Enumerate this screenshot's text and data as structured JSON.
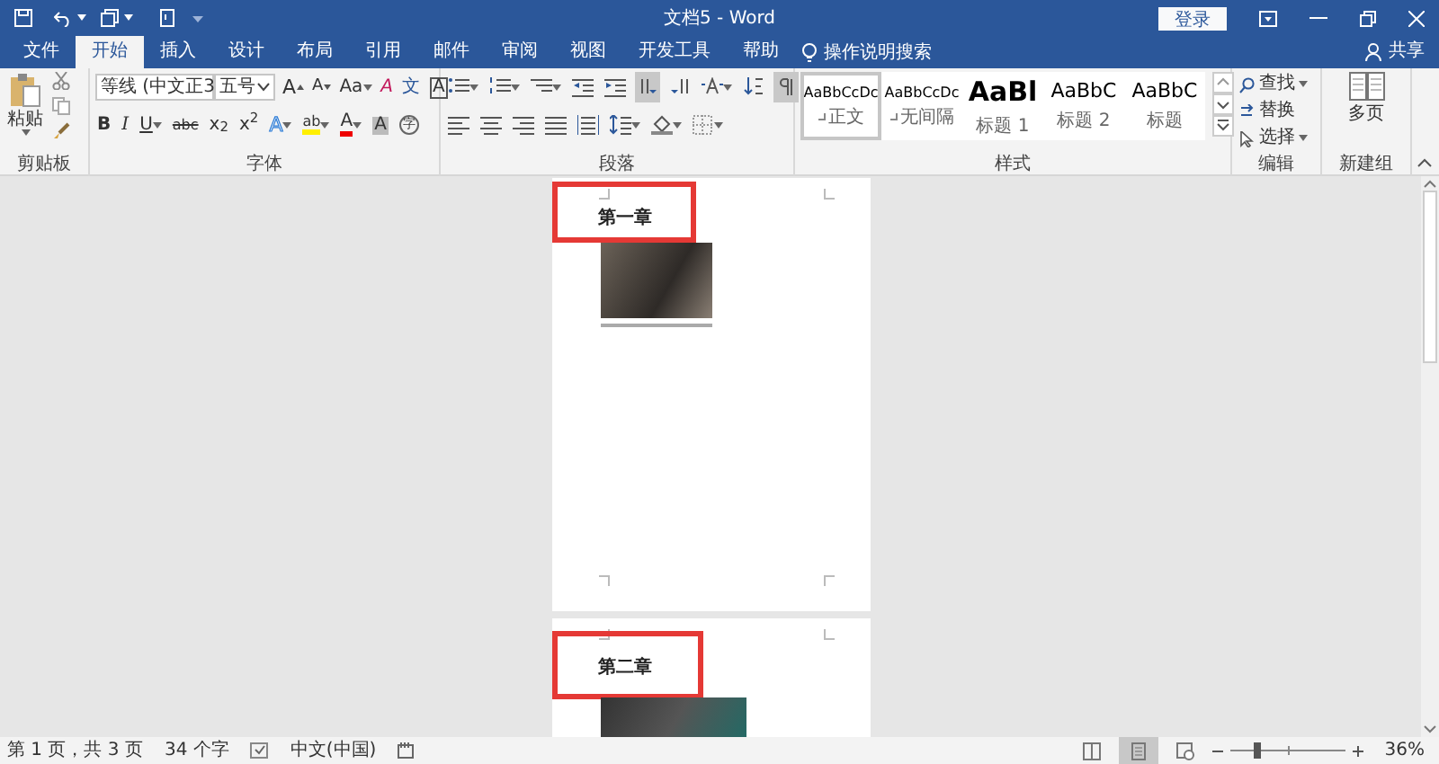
{
  "window": {
    "title": "文档5 - Word",
    "sign_in": "登录"
  },
  "tabs": [
    {
      "label": "文件",
      "selected": false
    },
    {
      "label": "开始",
      "selected": true
    },
    {
      "label": "插入",
      "selected": false
    },
    {
      "label": "设计",
      "selected": false
    },
    {
      "label": "布局",
      "selected": false
    },
    {
      "label": "引用",
      "selected": false
    },
    {
      "label": "邮件",
      "selected": false
    },
    {
      "label": "审阅",
      "selected": false
    },
    {
      "label": "视图",
      "selected": false
    },
    {
      "label": "开发工具",
      "selected": false
    },
    {
      "label": "帮助",
      "selected": false
    }
  ],
  "tell_me": "操作说明搜索",
  "share": "共享",
  "ribbon": {
    "clipboard": {
      "label": "剪贴板",
      "paste": "粘贴"
    },
    "font": {
      "label": "字体",
      "font_name": "等线 (中文正3",
      "font_size": "五号",
      "row1": [
        {
          "kind": "grow",
          "text": "A"
        },
        {
          "kind": "shrink",
          "text": "A"
        },
        {
          "kind": "case",
          "text": "Aa"
        },
        {
          "kind": "clear",
          "text": "A"
        },
        {
          "kind": "phonetic",
          "text": "文"
        },
        {
          "kind": "border",
          "text": "A"
        }
      ],
      "row2": [
        {
          "kind": "bold",
          "text": "B"
        },
        {
          "kind": "italic",
          "text": "I"
        },
        {
          "kind": "underline",
          "text": "U"
        },
        {
          "kind": "strike",
          "text": "abc"
        },
        {
          "kind": "plain",
          "text": "x$_{2}$"
        },
        {
          "kind": "plain",
          "text": "x$^{2}$"
        },
        {
          "kind": "effects",
          "text": "A"
        },
        {
          "kind": "highlight",
          "text": "ab"
        },
        {
          "kind": "color",
          "text": "A"
        },
        {
          "kind": "shade",
          "text": "A"
        },
        {
          "kind": "enclose",
          "text": "字"
        }
      ]
    },
    "paragraph": {
      "label": "段落",
      "row1": [
        {
          "kind": "bullets",
          "pressed": false
        },
        {
          "kind": "numbering",
          "pressed": false
        },
        {
          "kind": "multilevel",
          "pressed": false
        },
        {
          "kind": "outdent",
          "pressed": false
        },
        {
          "kind": "indent",
          "pressed": false
        },
        {
          "kind": "ltr",
          "pressed": true
        },
        {
          "kind": "rtl",
          "pressed": false
        },
        {
          "kind": "asian",
          "pressed": false
        },
        {
          "kind": "sort",
          "pressed": false
        },
        {
          "kind": "marks",
          "pressed": true
        }
      ],
      "row2": [
        {
          "kind": "align-left",
          "pressed": false
        },
        {
          "kind": "align-center",
          "pressed": false
        },
        {
          "kind": "align-right",
          "pressed": false
        },
        {
          "kind": "justify",
          "pressed": false
        },
        {
          "kind": "distribute",
          "pressed": false
        },
        {
          "kind": "spacing",
          "pressed": false
        },
        {
          "kind": "shading",
          "pressed": false
        },
        {
          "kind": "borders",
          "pressed": false
        }
      ]
    },
    "styles": {
      "label": "样式",
      "items": [
        {
          "preview": "AaBbCcDc",
          "name": "正文",
          "kind": "body",
          "selected": true
        },
        {
          "preview": "AaBbCcDc",
          "name": "无间隔",
          "kind": "body",
          "selected": false
        },
        {
          "preview": "AaBl",
          "name": "标题 1",
          "kind": "heading1",
          "selected": false
        },
        {
          "preview": "AaBbC",
          "name": "标题 2",
          "kind": "heading",
          "selected": false
        },
        {
          "preview": "AaBbC",
          "name": "标题",
          "kind": "heading",
          "selected": false
        }
      ]
    },
    "editing": {
      "label": "编辑",
      "items": [
        {
          "kind": "find",
          "label": "查找"
        },
        {
          "kind": "replace",
          "label": "替换"
        },
        {
          "kind": "select",
          "label": "选择"
        }
      ]
    },
    "new_group": {
      "label": "新建组",
      "button": "多页"
    }
  },
  "pages": [
    {
      "heading": "第一章",
      "highlighted": true,
      "kind": "phone"
    },
    {
      "heading": "第二章",
      "highlighted": true,
      "kind": "dark"
    }
  ],
  "status_bar": {
    "page": "第 1 页，共 3 页",
    "words": "34 个字",
    "language": "中文(中国)",
    "views": [
      {
        "kind": "read",
        "selected": false
      },
      {
        "kind": "print",
        "selected": true
      },
      {
        "kind": "web",
        "selected": false
      }
    ],
    "zoom": {
      "level": 0.24,
      "reading": "36%"
    }
  }
}
